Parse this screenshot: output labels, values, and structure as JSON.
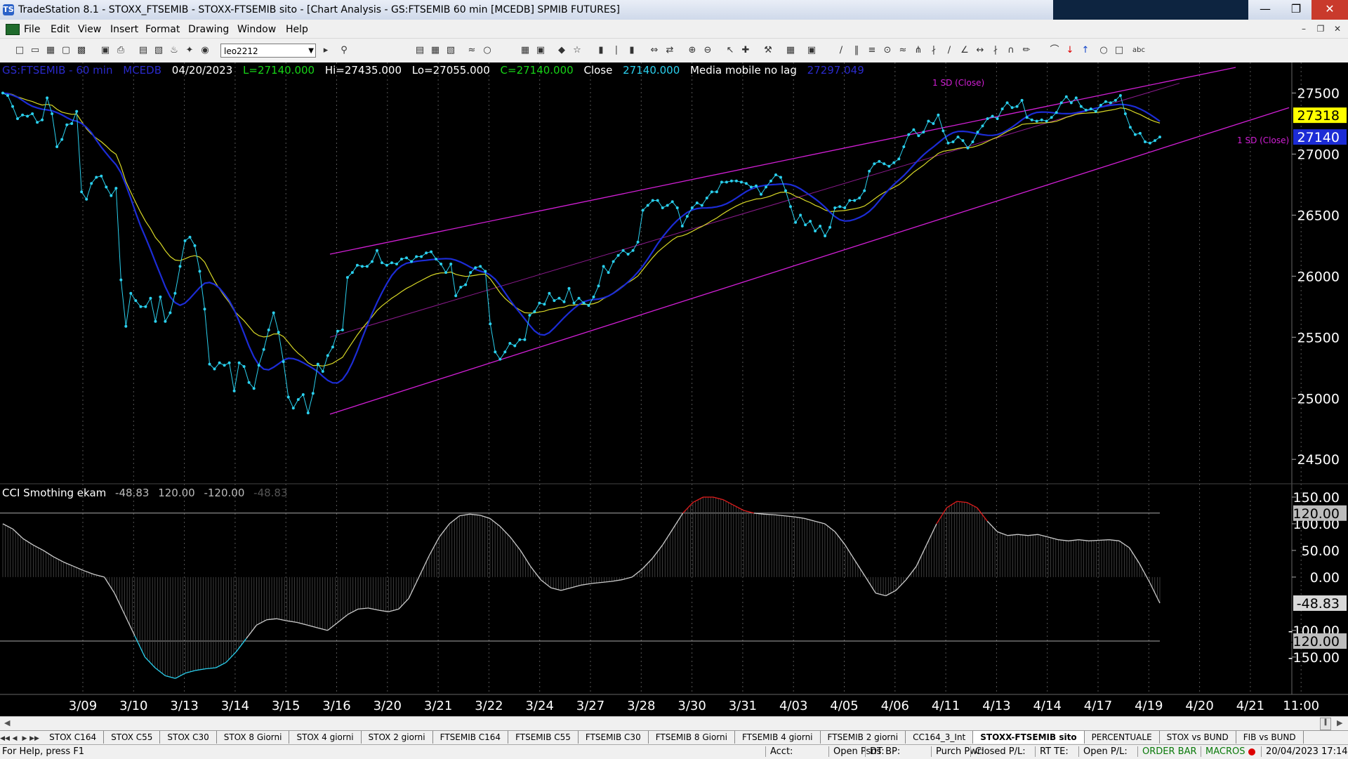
{
  "window": {
    "title": "TradeStation 8.1 - STOXX_FTSEMIB - STOXX-FTSEMIB sito - [Chart Analysis - GS:FTSEMIB  60 min  [MCEDB] SPMIB FUTURES]",
    "app_icon": "TS",
    "minimize_icon": "minimize-icon",
    "maximize_icon": "maximize-icon",
    "close_icon": "close-icon"
  },
  "menu": {
    "items": [
      "File",
      "Edit",
      "View",
      "Insert",
      "Format",
      "Drawing",
      "Window",
      "Help"
    ]
  },
  "toolbar": {
    "combo_value": "leo2212"
  },
  "chart": {
    "symbol": "GS:FTSEMIB - 60 min",
    "data_source": "MCEDB",
    "date": "04/20/2023",
    "last": "L=27140.000",
    "high": "Hi=27435.000",
    "low": "Lo=27055.000",
    "close": "C=27140.000",
    "close_label": "Close",
    "close_value": "27140.000",
    "indicator_name": "Media mobile no lag",
    "indicator_value": "27297.049",
    "sd_label_top": "1 SD (Close)",
    "sd_label_right": "1 SD (Close)",
    "price_marker_ma": "27318",
    "price_marker_close": "27140",
    "cci_name": "CCI Smothing ekam",
    "cci_value": "-48.83",
    "cci_upper": "120.00",
    "cci_lower": "-120.00",
    "cci_value_dim": "-48.83",
    "cci_marker_upper": "120.00",
    "cci_marker_value": "-48.83",
    "cci_marker_lower": "-120.00",
    "colors": {
      "price": "#2ad0ee",
      "ma_blue": "#1c2cd6",
      "ma_yellow": "#d8d826",
      "channel": "#d21fd6",
      "info_green": "#17d417",
      "info_cyan": "#2ad0ee",
      "info_blue": "#2a2acc"
    }
  },
  "chart_data": [
    {
      "type": "line",
      "title": "GS:FTSEMIB - 60 min",
      "y_ticks": [
        27500,
        27000,
        26500,
        26000,
        25500,
        25000,
        24500
      ],
      "ylim": [
        24300,
        27750
      ],
      "x_ticks": [
        "3/09",
        "3/10",
        "3/13",
        "3/14",
        "3/15",
        "3/16",
        "3/20",
        "3/21",
        "3/22",
        "3/24",
        "3/27",
        "3/28",
        "3/30",
        "3/31",
        "4/03",
        "4/05",
        "4/06",
        "4/11",
        "4/13",
        "4/14",
        "4/17",
        "4/19",
        "4/20",
        "4/21",
        "11:00"
      ],
      "series": [
        {
          "values": [
            27500,
            27480,
            27390,
            27290,
            27320,
            27310,
            27330,
            27260,
            27280,
            27460,
            27330,
            27060,
            27120,
            27240,
            27250,
            27350,
            26690,
            26630,
            26760,
            26810,
            26820,
            26730,
            26660,
            26720,
            25970,
            25590,
            25860,
            25800,
            25750,
            25750,
            25820,
            25630,
            25830,
            25630,
            25700,
            25860,
            26080,
            26290,
            26320,
            26250,
            26040,
            25730,
            25280,
            25240,
            25290,
            25270,
            25290,
            25060,
            25290,
            25260,
            25130,
            25080,
            25270,
            25400,
            25560,
            25700,
            25540,
            25300,
            25010,
            24920,
            24990,
            25030,
            24880,
            25040,
            25280,
            25220,
            25350,
            25420,
            25550,
            25560,
            25990,
            26030,
            26090,
            26080,
            26080,
            26120,
            26210,
            26110,
            26090,
            26110,
            26100,
            26140,
            26150,
            26120,
            26160,
            26160,
            26190,
            26200,
            26140,
            26100,
            26030,
            26100,
            25840,
            25910,
            25930,
            26030,
            26070,
            26080,
            26040,
            25610,
            25380,
            25320,
            25380,
            25450,
            25430,
            25480,
            25480,
            25680,
            25710,
            25780,
            25770,
            25860,
            25800,
            25820,
            25790,
            25900,
            25780,
            25820,
            25780,
            25760,
            25830,
            25920,
            26080,
            26030,
            26120,
            26170,
            26210,
            26180,
            26210,
            26280,
            26540,
            26580,
            26620,
            26620,
            26560,
            26580,
            26610,
            26560,
            26410,
            26490,
            26560,
            26600,
            26580,
            26640,
            26690,
            26690,
            26770,
            26770,
            26780,
            26780,
            26770,
            26760,
            26730,
            26740,
            26670,
            26730,
            26780,
            26830,
            26810,
            26700,
            26570,
            26440,
            26500,
            26420,
            26450,
            26370,
            26410,
            26330,
            26400,
            26560,
            26570,
            26560,
            26620,
            26620,
            26640,
            26700,
            26860,
            26920,
            26940,
            26920,
            26900,
            26930,
            26960,
            27060,
            27160,
            27200,
            27150,
            27180,
            27270,
            27250,
            27320,
            27190,
            27090,
            27100,
            27140,
            27110,
            27050,
            27100,
            27180,
            27230,
            27290,
            27310,
            27290,
            27370,
            27420,
            27380,
            27390,
            27440,
            27300,
            27280,
            27270,
            27280,
            27270,
            27300,
            27340,
            27420,
            27470,
            27420,
            27460,
            27390,
            27360,
            27370,
            27350,
            27400,
            27430,
            27420,
            27440,
            27480,
            27330,
            27220,
            27160,
            27170,
            27100,
            27090,
            27110,
            27140
          ]
        }
      ]
    },
    {
      "type": "area",
      "title": "CCI Smothing ekam",
      "y_ticks": [
        150,
        100,
        50,
        0,
        -100,
        -150
      ],
      "ylim": [
        -220,
        175
      ],
      "reference_lines": [
        120,
        -120
      ],
      "series": [
        {
          "values": [
            100,
            90,
            72,
            60,
            50,
            38,
            28,
            20,
            12,
            5,
            0,
            -30,
            -70,
            -110,
            -150,
            -170,
            -185,
            -190,
            -180,
            -175,
            -172,
            -170,
            -160,
            -140,
            -115,
            -90,
            -80,
            -78,
            -82,
            -85,
            -90,
            -95,
            -100,
            -85,
            -70,
            -60,
            -58,
            -62,
            -65,
            -60,
            -40,
            0,
            40,
            75,
            100,
            115,
            118,
            116,
            110,
            95,
            75,
            50,
            20,
            -5,
            -20,
            -25,
            -20,
            -15,
            -12,
            -10,
            -8,
            -5,
            0,
            15,
            35,
            60,
            90,
            120,
            140,
            150,
            150,
            145,
            135,
            125,
            120,
            118,
            117,
            115,
            113,
            110,
            105,
            100,
            85,
            60,
            30,
            0,
            -30,
            -35,
            -25,
            -5,
            20,
            60,
            100,
            130,
            142,
            140,
            130,
            105,
            85,
            78,
            80,
            78,
            80,
            75,
            70,
            68,
            70,
            68,
            69,
            70,
            68,
            55,
            25,
            -10,
            -48.83
          ]
        }
      ]
    }
  ],
  "tabs": [
    "STOX C164",
    "STOX C55",
    "STOX  C30",
    "STOX  8 Giorni",
    "STOX 4 giorni",
    "STOX  2 giorni",
    "FTSEMIB C164",
    "FTSEMIB C55",
    "FTSEMIB C30",
    "FTSEMIB  8 Giorni",
    "FTSEMIB  4 giorni",
    "FTSEMIB  2 giorni",
    "CC164_3_Int",
    "STOXX-FTSEMIB sito",
    "PERCENTUALE",
    "STOX vs BUND",
    "FIB vs BUND"
  ],
  "active_tab": "STOXX-FTSEMIB sito",
  "status": {
    "help": "For Help, press F1",
    "acct": "Acct:",
    "open_psns": "Open Psns:",
    "dt_bp": "DT BP:",
    "purch_pwr": "Purch Pwr:",
    "closed_pl": "Closed P/L:",
    "rt_te": "RT TE:",
    "open_pl": "Open P/L:",
    "order_bar": "ORDER BAR",
    "macros": "MACROS",
    "datetime": "20/04/2023 17:14"
  }
}
